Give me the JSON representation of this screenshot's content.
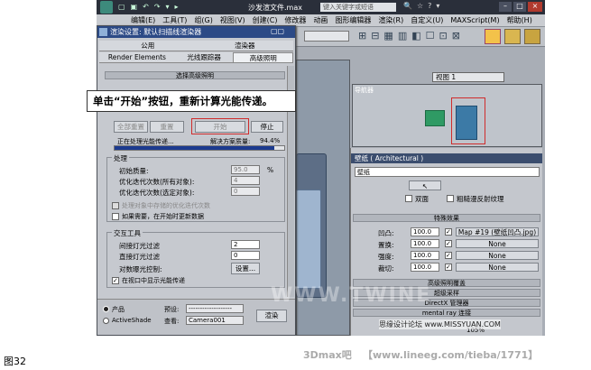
{
  "app": {
    "title": "沙发渲文件.max",
    "search_placeholder": "键入关键字或短语"
  },
  "menu": [
    "编辑(E)",
    "工具(T)",
    "组(G)",
    "视图(V)",
    "创建(C)",
    "修改器",
    "动画",
    "图形编辑器",
    "渲染(R)",
    "自定义(U)",
    "MAXScript(M)",
    "帮助(H)"
  ],
  "dialog": {
    "title": "渲染设置: 默认扫描线渲染器",
    "tabs_row1": [
      "公用",
      "渲染器"
    ],
    "tabs_row2": [
      "Render Elements",
      "光线跟踪器",
      "高级照明"
    ],
    "rollup_title": "选择高级照明",
    "buttons": {
      "reset_all": "全部重置",
      "reset": "重置",
      "start": "开始",
      "stop": "停止"
    },
    "progress": {
      "status": "正在处理光能传递...",
      "quality_label": "解决方案质量:",
      "quality_value": "94.4%",
      "fill": 0.94
    },
    "processing": {
      "title": "处理",
      "initial_quality_label": "初始质量:",
      "initial_quality_value": "95.0",
      "initial_quality_unit": "%",
      "refine_all_label": "优化迭代次数(所有对象):",
      "refine_all_value": "4",
      "refine_sel_label": "优化迭代次数(选定对象):",
      "refine_sel_value": "0",
      "cb_stored": "处理对象中存储的优化迭代次数",
      "cb_update": "如果需要，在开始时更新数据"
    },
    "interactive": {
      "title": "交互工具",
      "indirect_label": "间接灯光过滤",
      "indirect_value": "2",
      "direct_label": "直接灯光过滤",
      "direct_value": "0",
      "exposure_label": "对数曝光控制:",
      "setup_btn": "设置...",
      "display_cb": "在视口中显示光能传递"
    },
    "footer": {
      "product_opt": "产品",
      "activeshade_opt": "ActiveShade",
      "preset_label": "预设:",
      "preset_value": "-------------------",
      "view_label": "查看:",
      "view_value": "Camera001",
      "render_btn": "渲染"
    }
  },
  "viewport": {
    "top_dropdown": "视图 1",
    "navigator_label": "导航器"
  },
  "command_panel": {
    "material_header": "壁纸 ( Architectural )",
    "material_name": "壁纸",
    "two_sided": "双面",
    "rough_diffuse": "粗糙漫反射纹理",
    "special_effects_title": "特殊效果",
    "rows": [
      {
        "label": "凹凸:",
        "value": "100.0",
        "map": "Map #19 (壁纸凹凸.jpg)",
        "checked": true
      },
      {
        "label": "置换:",
        "value": "100.0",
        "map": "None",
        "checked": true
      },
      {
        "label": "强度:",
        "value": "100.0",
        "map": "None",
        "checked": true
      },
      {
        "label": "裁切:",
        "value": "100.0",
        "map": "None",
        "checked": true
      }
    ],
    "rollups": [
      "高级照明覆盖",
      "超级采样",
      "DirectX 管理器",
      "mental ray 连接"
    ]
  },
  "status": {
    "zoom": "105%"
  },
  "callout": "单击“开始”按钮，重新计算光能传递。",
  "caption": "图32",
  "watermarks": {
    "site_right": "思缘设计论坛 www.MISSYUAN.COM",
    "bottom_left": "3Dmax吧",
    "bottom_url": "【www.lineeg.com/tieba/1771】",
    "diag": "WWW.TWINE"
  }
}
